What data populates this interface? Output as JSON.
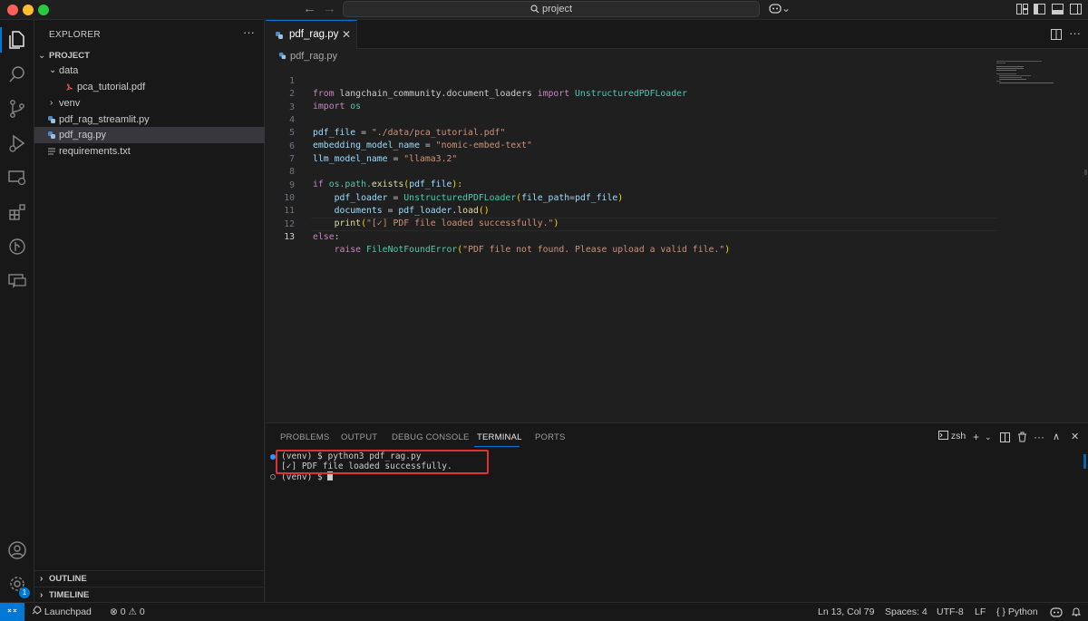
{
  "titlebar": {
    "search_text": "project",
    "copilot_label": "⌄"
  },
  "sidebar": {
    "title": "EXPLORER",
    "more": "···",
    "project": "PROJECT",
    "tree": [
      {
        "label": "data",
        "type": "folder-open"
      },
      {
        "label": "pca_tutorial.pdf",
        "type": "pdf"
      },
      {
        "label": "venv",
        "type": "folder-closed"
      },
      {
        "label": "pdf_rag_streamlit.py",
        "type": "python"
      },
      {
        "label": "pdf_rag.py",
        "type": "python",
        "selected": true
      },
      {
        "label": "requirements.txt",
        "type": "text"
      }
    ],
    "outline": "OUTLINE",
    "timeline": "TIMELINE"
  },
  "editor": {
    "tab_label": "pdf_rag.py",
    "breadcrumb": "pdf_rag.py",
    "line_numbers": [
      "1",
      "2",
      "3",
      "4",
      "5",
      "6",
      "7",
      "8",
      "9",
      "10",
      "11",
      "12",
      "13"
    ],
    "tokens": {
      "from": "from",
      "module": " langchain_community.document_loaders ",
      "import": "import",
      "cls_loader": " UnstructuredPDFLoader",
      "import_os_kw": "import",
      "os": " os",
      "pdf_file": "pdf_file",
      "eq": " = ",
      "pdf_path": "\"./data/pca_tutorial.pdf\"",
      "embed_var": "embedding_model_name",
      "embed_val": "\"nomic-embed-text\"",
      "llm_var": "llm_model_name",
      "llm_val": "\"llama3.2\"",
      "if": "if",
      "os_path": " os.path.",
      "exists": "exists",
      "lparen": "(",
      "pdf_file_arg": "pdf_file",
      "rparen_colon": "):",
      "indent": "    ",
      "pdf_loader": "pdf_loader",
      "cls_call": "UnstructuredPDFLoader",
      "kwarg": "file_path",
      "eq2": "=",
      "pdf_file_val": "pdf_file",
      "rparen": ")",
      "documents": "documents",
      "loader_load": "pdf_loader.",
      "load": "load",
      "empty_parens": "()",
      "print": "print",
      "print_str": "\"[✓] PDF file loaded successfully.\"",
      "else": "else",
      "colon": ":",
      "raise": "raise",
      "error_cls": " FileNotFoundError",
      "error_str": "\"PDF file not found. Please upload a valid file.\""
    }
  },
  "panel": {
    "tabs": [
      "PROBLEMS",
      "OUTPUT",
      "DEBUG CONSOLE",
      "TERMINAL",
      "PORTS"
    ],
    "active_tab": "TERMINAL",
    "shell": "zsh",
    "terminal_lines": [
      "(venv) $ python3 pdf_rag.py",
      "[✓] PDF file loaded successfully.",
      "(venv) $ "
    ]
  },
  "statusbar": {
    "launchpad": "Launchpad",
    "errors": "0",
    "warnings": "0",
    "cursor_pos": "Ln 13, Col 79",
    "spaces": "Spaces: 4",
    "encoding": "UTF-8",
    "eol": "LF",
    "language": "Python",
    "language_braces": "{ }"
  },
  "activity": {
    "accounts_badge": "1"
  },
  "colors": {
    "accent": "#0078d4",
    "highlight_box": "#e03131"
  }
}
